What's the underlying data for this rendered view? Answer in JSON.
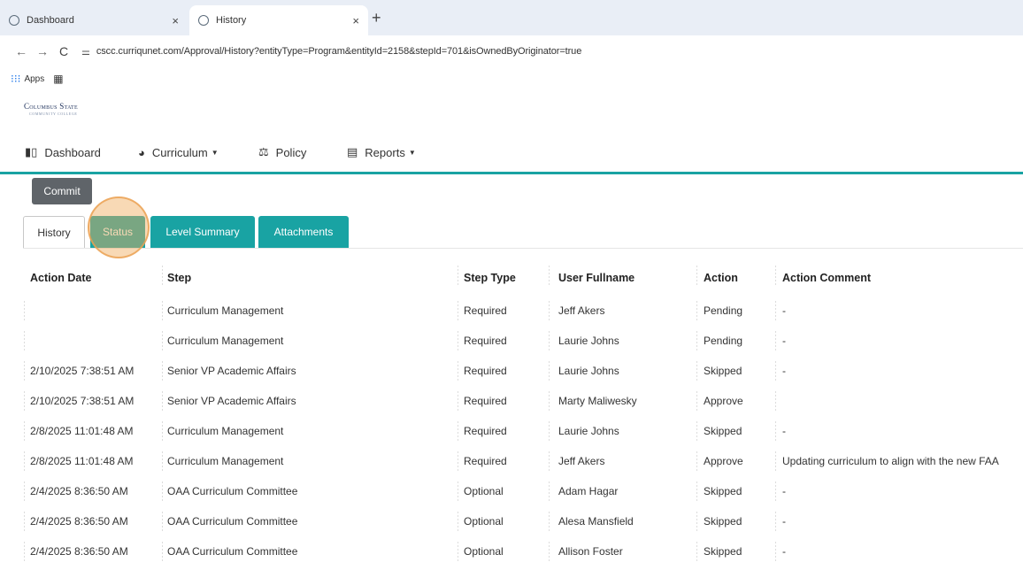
{
  "browser": {
    "tabs": [
      {
        "title": "Dashboard",
        "close": "×"
      },
      {
        "title": "History",
        "close": "×"
      }
    ],
    "new_tab": "+",
    "nav": {
      "back": "←",
      "forward": "→",
      "reload": "C"
    },
    "url": "cscc.curriqunet.com/Approval/History?entityType=Program&entityId=2158&stepId=701&isOwnedByOriginator=true",
    "bookmarks": {
      "apps_label": "Apps"
    }
  },
  "logo": {
    "title": "Columbus State",
    "subtitle": "COMMUNITY COLLEGE"
  },
  "main_nav": {
    "dashboard": "Dashboard",
    "curriculum": "Curriculum",
    "policy": "Policy",
    "reports": "Reports"
  },
  "commit_label": "Commit",
  "tabs": {
    "history": "History",
    "status": "Status",
    "level_summary": "Level Summary",
    "attachments": "Attachments"
  },
  "table": {
    "headers": {
      "action_date": "Action Date",
      "step": "Step",
      "step_type": "Step Type",
      "user_fullname": "User Fullname",
      "action": "Action",
      "action_comment": "Action Comment"
    },
    "rows": [
      {
        "date": "",
        "step": "Curriculum Management",
        "type": "Required",
        "user": "Jeff Akers",
        "action": "Pending",
        "comment": "-"
      },
      {
        "date": "",
        "step": "Curriculum Management",
        "type": "Required",
        "user": "Laurie Johns",
        "action": "Pending",
        "comment": "-"
      },
      {
        "date": "2/10/2025 7:38:51 AM",
        "step": "Senior VP Academic Affairs",
        "type": "Required",
        "user": "Laurie Johns",
        "action": "Skipped",
        "comment": "-"
      },
      {
        "date": "2/10/2025 7:38:51 AM",
        "step": "Senior VP Academic Affairs",
        "type": "Required",
        "user": "Marty Maliwesky",
        "action": "Approve",
        "comment": ""
      },
      {
        "date": "2/8/2025 11:01:48 AM",
        "step": "Curriculum Management",
        "type": "Required",
        "user": "Laurie Johns",
        "action": "Skipped",
        "comment": "-"
      },
      {
        "date": "2/8/2025 11:01:48 AM",
        "step": "Curriculum Management",
        "type": "Required",
        "user": "Jeff Akers",
        "action": "Approve",
        "comment": "Updating curriculum to align with the new FAA"
      },
      {
        "date": "2/4/2025 8:36:50 AM",
        "step": "OAA Curriculum Committee",
        "type": "Optional",
        "user": "Adam Hagar",
        "action": "Skipped",
        "comment": "-"
      },
      {
        "date": "2/4/2025 8:36:50 AM",
        "step": "OAA Curriculum Committee",
        "type": "Optional",
        "user": "Alesa Mansfield",
        "action": "Skipped",
        "comment": "-"
      },
      {
        "date": "2/4/2025 8:36:50 AM",
        "step": "OAA Curriculum Committee",
        "type": "Optional",
        "user": "Allison Foster",
        "action": "Skipped",
        "comment": "-"
      }
    ]
  }
}
